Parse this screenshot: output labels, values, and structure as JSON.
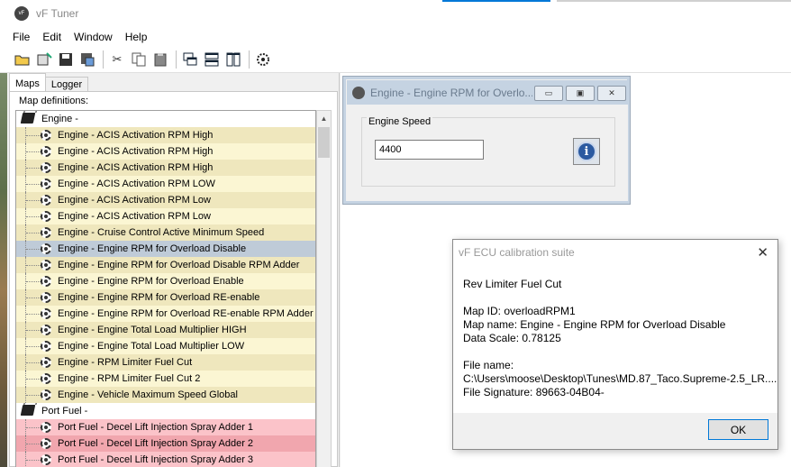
{
  "window": {
    "title": "vF Tuner",
    "icon": "vf-logo-icon"
  },
  "menu": [
    "File",
    "Edit",
    "Window",
    "Help"
  ],
  "toolbar": {
    "buttons": [
      "open-folder-icon",
      "open-file-icon",
      "save-icon",
      "save-as-icon",
      "cut-icon",
      "copy-icon",
      "paste-icon",
      "cascade-icon",
      "tile-horizontal-icon",
      "tile-vertical-icon",
      "settings-gear-icon"
    ]
  },
  "left_panel": {
    "tabs": [
      "Maps",
      "Logger"
    ],
    "active_tab": "Maps",
    "section_label": "Map definitions:",
    "tree": {
      "engine_group": "Engine -",
      "engine_items": [
        "Engine - ACIS Activation RPM High",
        "Engine - ACIS Activation RPM High",
        "Engine - ACIS Activation RPM High",
        "Engine - ACIS Activation RPM LOW",
        "Engine - ACIS Activation RPM Low",
        "Engine - ACIS Activation RPM Low",
        "Engine - Cruise Control Active Minimum Speed",
        "Engine - Engine RPM for Overload Disable",
        "Engine - Engine RPM for Overload Disable RPM Adder",
        "Engine - Engine RPM for Overload Enable",
        "Engine - Engine RPM for Overload RE-enable",
        "Engine - Engine RPM for Overload RE-enable RPM Adder",
        "Engine - Engine Total Load Multiplier HIGH",
        "Engine - Engine Total Load Multiplier LOW",
        "Engine - RPM Limiter Fuel Cut",
        "Engine - RPM Limiter Fuel Cut 2",
        "Engine - Vehicle Maximum Speed Global"
      ],
      "selected_item": "Engine - Engine RPM for Overload Disable",
      "port_fuel_group": "Port Fuel -",
      "port_fuel_items": [
        "Port Fuel - Decel Lift Injection Spray Adder 1",
        "Port Fuel - Decel Lift Injection Spray Adder 2",
        "Port Fuel - Decel Lift Injection Spray Adder 3"
      ]
    }
  },
  "child_window": {
    "title": "Engine - Engine RPM for Overlo...",
    "group_label": "Engine Speed",
    "value": "4400",
    "buttons": [
      "minimize-icon",
      "restore-icon",
      "close-icon"
    ]
  },
  "dialog": {
    "title": "vF ECU calibration suite",
    "heading": "Rev Limiter Fuel Cut",
    "map_id": "Map ID: overloadRPM1",
    "map_name": "Map name: Engine - Engine RPM for Overload Disable",
    "data_scale": "Data Scale: 0.78125",
    "file_name_label": "File name:",
    "file_path": "C:\\Users\\moose\\Desktop\\Tunes\\MD.87_Taco.Supreme-2.5_LR....",
    "file_signature": "File Signature: 89663-04B04-",
    "ok_label": "OK"
  }
}
